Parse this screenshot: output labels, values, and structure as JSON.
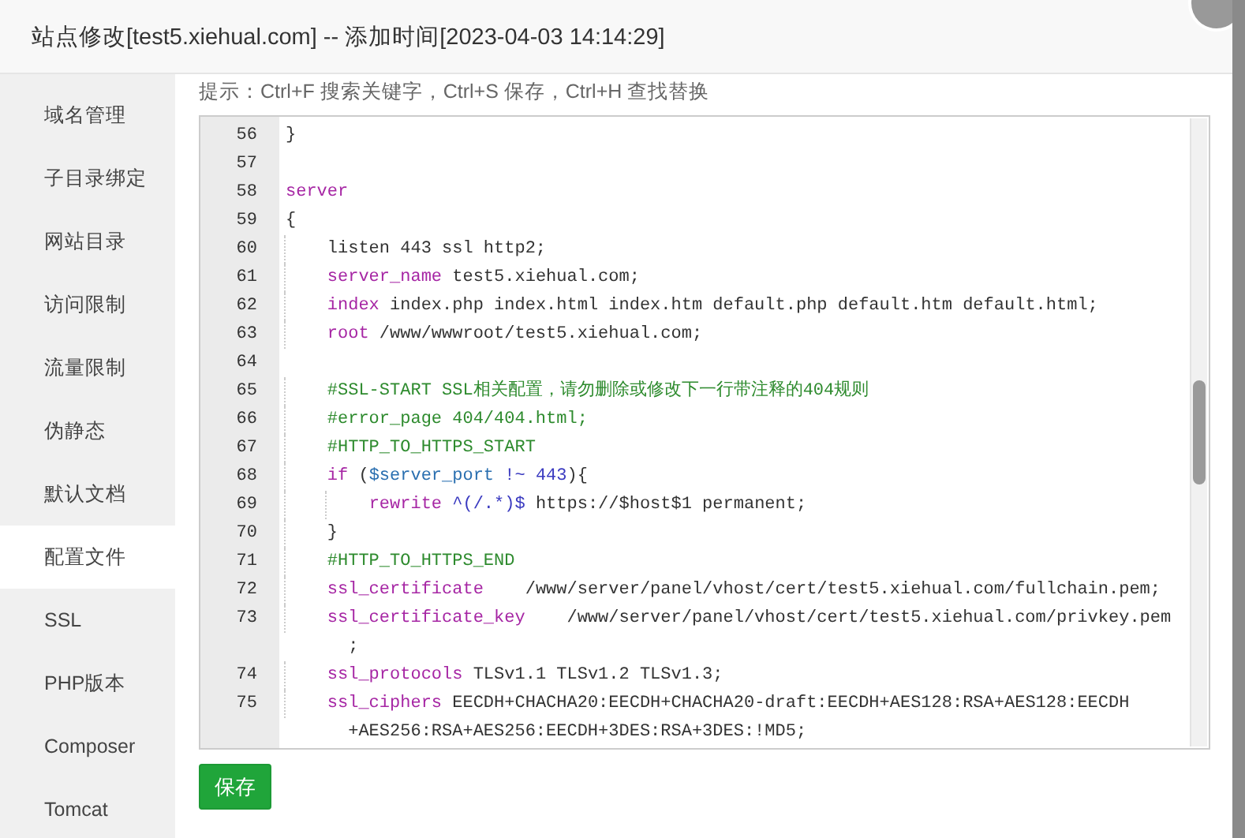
{
  "window": {
    "title": "站点修改[test5.xiehual.com] -- 添加时间[2023-04-03 14:14:29]"
  },
  "sidebar": {
    "items": [
      {
        "label": "域名管理",
        "selected": false
      },
      {
        "label": "子目录绑定",
        "selected": false
      },
      {
        "label": "网站目录",
        "selected": false
      },
      {
        "label": "访问限制",
        "selected": false
      },
      {
        "label": "流量限制",
        "selected": false
      },
      {
        "label": "伪静态",
        "selected": false
      },
      {
        "label": "默认文档",
        "selected": false
      },
      {
        "label": "配置文件",
        "selected": true
      },
      {
        "label": "SSL",
        "selected": false
      },
      {
        "label": "PHP版本",
        "selected": false
      },
      {
        "label": "Composer",
        "selected": false
      },
      {
        "label": "Tomcat",
        "selected": false
      }
    ]
  },
  "hint": "提示：Ctrl+F 搜索关键字，Ctrl+S 保存，Ctrl+H 查找替换",
  "editor": {
    "lines": [
      {
        "number": "56",
        "tokens": [
          {
            "t": "}",
            "kind": "plain"
          }
        ]
      },
      {
        "number": "57"
      },
      {
        "number": "58",
        "tokens": [
          {
            "t": "server",
            "kind": "keyword"
          }
        ]
      },
      {
        "number": "59",
        "tokens": [
          {
            "t": "{",
            "kind": "plain"
          }
        ]
      },
      {
        "number": "60",
        "tokens": [
          {
            "t": "    listen 443 ssl http2;",
            "kind": "plain"
          }
        ]
      },
      {
        "number": "61",
        "tokens": [
          {
            "t": "    server_name",
            "kind": "keyword"
          },
          {
            "t": " test5.xiehual.com;",
            "kind": "plain"
          }
        ]
      },
      {
        "number": "62",
        "tokens": [
          {
            "t": "    index",
            "kind": "keyword"
          },
          {
            "t": " index.php index.html index.htm default.php default.htm default.html;",
            "kind": "plain"
          }
        ]
      },
      {
        "number": "63",
        "tokens": [
          {
            "t": "    root",
            "kind": "keyword"
          },
          {
            "t": " /www/wwwroot/test5.xiehual.com;",
            "kind": "plain"
          }
        ]
      },
      {
        "number": "64"
      },
      {
        "number": "65",
        "tokens": [
          {
            "t": "    #SSL-START SSL相关配置，请勿删除或修改下一行带注释的404规则",
            "kind": "comment"
          }
        ]
      },
      {
        "number": "66",
        "tokens": [
          {
            "t": "    #error_page 404/404.html;",
            "kind": "comment"
          }
        ]
      },
      {
        "number": "67",
        "tokens": [
          {
            "t": "    #HTTP_TO_HTTPS_START",
            "kind": "comment"
          }
        ]
      },
      {
        "number": "68",
        "tokens": [
          {
            "t": "    if",
            "kind": "keyword"
          },
          {
            "t": " (",
            "kind": "plain"
          },
          {
            "t": "$server_port",
            "kind": "variable"
          },
          {
            "t": " !~ ",
            "kind": "operator"
          },
          {
            "t": "443",
            "kind": "operator"
          },
          {
            "t": "){",
            "kind": "plain"
          }
        ]
      },
      {
        "number": "69",
        "tokens": [
          {
            "t": "        rewrite",
            "kind": "keyword"
          },
          {
            "t": " ^(/.*)$",
            "kind": "operator"
          },
          {
            "t": " https://$host$1 permanent;",
            "kind": "plain"
          }
        ]
      },
      {
        "number": "70",
        "tokens": [
          {
            "t": "    }",
            "kind": "plain"
          }
        ]
      },
      {
        "number": "71",
        "tokens": [
          {
            "t": "    #HTTP_TO_HTTPS_END",
            "kind": "comment"
          }
        ]
      },
      {
        "number": "72",
        "tokens": [
          {
            "t": "    ssl_certificate",
            "kind": "keyword"
          },
          {
            "t": "    /www/server/panel/vhost/cert/test5.xiehual.com/fullchain.pem;",
            "kind": "plain"
          }
        ]
      },
      {
        "number": "73",
        "tokens": [
          {
            "t": "    ssl_certificate_key",
            "kind": "keyword"
          },
          {
            "t": "    /www/server/panel/vhost/cert/test5.xiehual.com/privkey.pem",
            "kind": "plain"
          }
        ],
        "wrapped": ";"
      },
      {
        "number": "74",
        "tokens": [
          {
            "t": "    ssl_protocols",
            "kind": "keyword"
          },
          {
            "t": " TLSv1.1 TLSv1.2 TLSv1.3;",
            "kind": "plain"
          }
        ]
      },
      {
        "number": "75",
        "tokens": [
          {
            "t": "    ssl_ciphers",
            "kind": "keyword"
          },
          {
            "t": " EECDH+CHACHA20:EECDH+CHACHA20-draft:EECDH+AES128:RSA+AES128:EECDH",
            "kind": "plain"
          }
        ],
        "wrapped": "+AES256:RSA+AES256:EECDH+3DES:RSA+3DES:!MD5;"
      }
    ]
  },
  "save_button": "保存"
}
